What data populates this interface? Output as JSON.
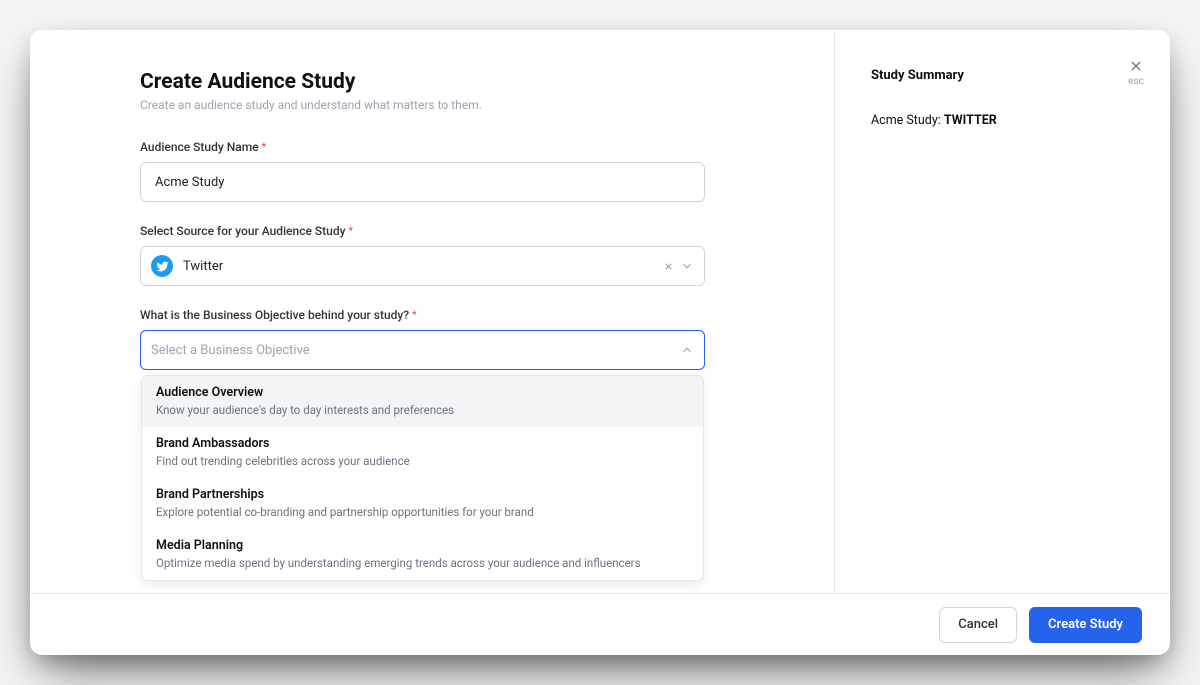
{
  "header": {
    "title": "Create Audience Study",
    "subtitle": "Create an audience study and understand what matters to them."
  },
  "fields": {
    "name": {
      "label": "Audience Study Name",
      "value": "Acme Study"
    },
    "source": {
      "label": "Select Source for your Audience Study",
      "icon": "twitter-icon",
      "value": "Twitter"
    },
    "objective": {
      "label": "What is the Business Objective behind your study?",
      "placeholder": "Select a Business Objective",
      "options": [
        {
          "title": "Audience Overview",
          "desc": "Know your audience's day to day interests and preferences"
        },
        {
          "title": "Brand Ambassadors",
          "desc": "Find out trending celebrities across your audience"
        },
        {
          "title": "Brand Partnerships",
          "desc": "Explore potential co-branding and partnership opportunities for your brand"
        },
        {
          "title": "Media Planning",
          "desc": "Optimize media spend by understanding emerging trends across your audience and influencers"
        }
      ]
    }
  },
  "summary": {
    "title": "Study Summary",
    "prefix": "Acme Study: ",
    "value": "TWITTER"
  },
  "close": {
    "label": "esc"
  },
  "footer": {
    "cancel": "Cancel",
    "submit": "Create Study"
  }
}
